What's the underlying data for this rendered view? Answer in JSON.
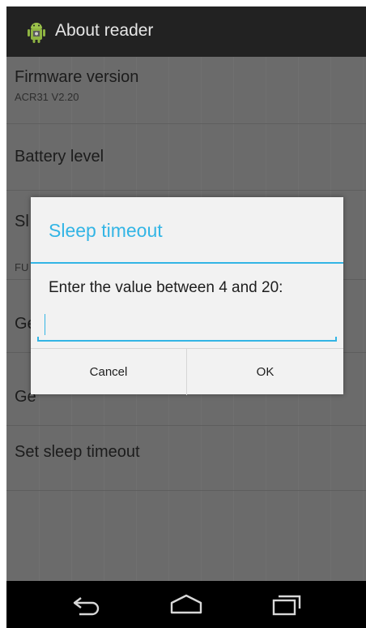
{
  "action_bar": {
    "title": "About reader",
    "icon": "android-app-icon"
  },
  "list": {
    "items": [
      {
        "title": "Firmware version",
        "subtitle": "ACR31 V2.20"
      },
      {
        "title": "Battery level",
        "subtitle": ""
      },
      {
        "title": "Sl",
        "subtitle": "FU"
      },
      {
        "title": "Ge",
        "subtitle": ""
      },
      {
        "title": "Ge",
        "subtitle": ""
      },
      {
        "title": "Set sleep timeout",
        "subtitle": ""
      }
    ]
  },
  "dialog": {
    "title": "Sleep timeout",
    "message": "Enter the value between 4 and 20:",
    "input_value": "",
    "cancel_label": "Cancel",
    "ok_label": "OK"
  },
  "navbar": {
    "back_icon": "back-icon",
    "home_icon": "home-icon",
    "recents_icon": "recents-icon"
  },
  "colors": {
    "accent": "#33b5e5",
    "action_bar": "#222222",
    "dim_background": "#6b6b6b"
  }
}
